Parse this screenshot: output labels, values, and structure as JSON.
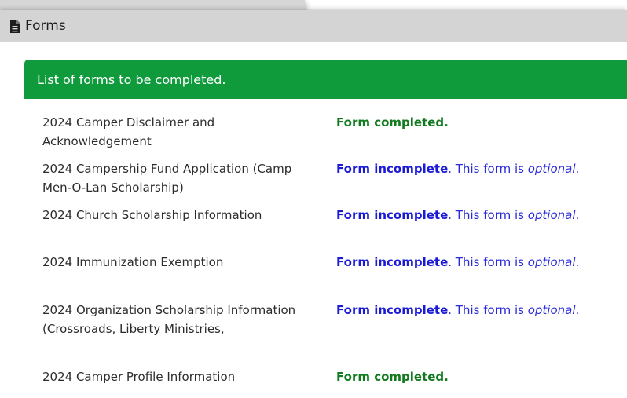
{
  "panel": {
    "title": "Forms",
    "icon": "document-icon"
  },
  "card": {
    "heading": "List of forms to be completed."
  },
  "forms": [
    {
      "name": "2024 Camper Disclaimer and Acknowledgement",
      "status": "Form completed.",
      "note": "",
      "optional": "",
      "end": ""
    },
    {
      "name": "2024 Campership Fund Application (Camp Men-O-Lan Scholarship)",
      "status": "Form incomplete",
      "note": ". This form is ",
      "optional": "optional",
      "end": "."
    },
    {
      "name": "2024 Church Scholarship Information",
      "status": "Form incomplete",
      "note": ". This form is ",
      "optional": "optional",
      "end": "."
    },
    {
      "name": "2024 Immunization Exemption",
      "status": "Form incomplete",
      "note": ". This form is ",
      "optional": "optional",
      "end": "."
    },
    {
      "name": "2024 Organization Scholarship Information (Crossroads, Liberty Ministries,",
      "status": "Form incomplete",
      "note": ". This form is ",
      "optional": "optional",
      "end": "."
    },
    {
      "name": "2024 Camper Profile Information",
      "status": "Form completed.",
      "note": "",
      "optional": "",
      "end": ""
    }
  ],
  "colors": {
    "header_green": "#0f9a3c",
    "completed_green": "#107a1d",
    "incomplete_blue": "#1b1bd6",
    "panel_gray": "#d4d4d4"
  }
}
